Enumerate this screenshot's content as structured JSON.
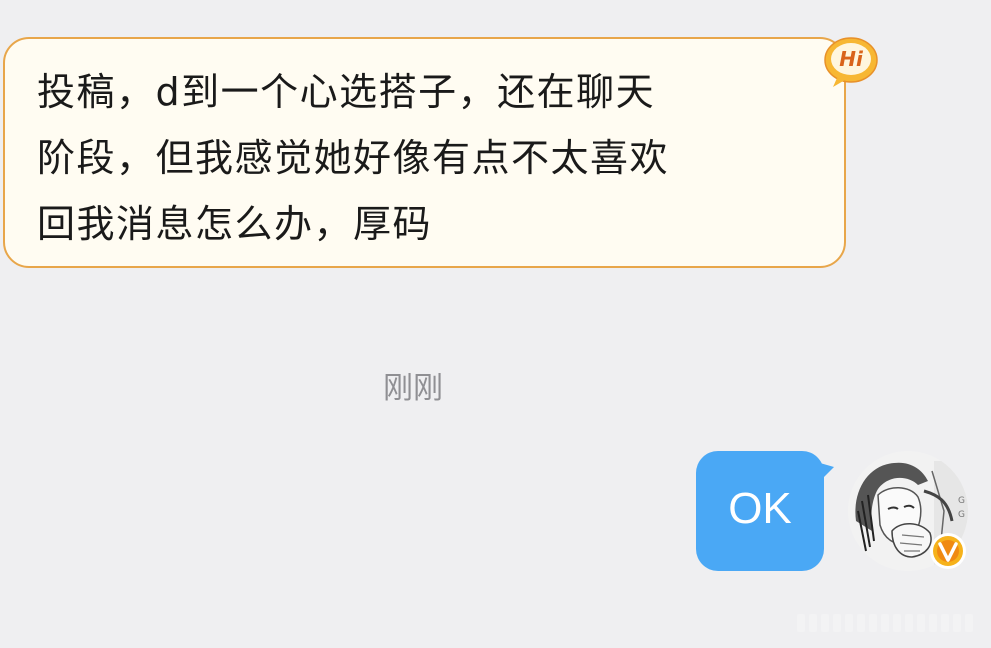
{
  "conversation": {
    "incoming_message": {
      "text": "投稿，d到一个心选搭子，还在聊天\n阶段，但我感觉她好像有点不太喜欢\n回我消息怎么办，厚码",
      "badge_text": "Hi",
      "badge_icon": "hi-speech-badge-icon"
    },
    "timestamp": "刚刚",
    "outgoing_message": {
      "text": "OK"
    },
    "avatar": {
      "icon": "user-avatar-sketch-icon",
      "verified_badge": "verified-v-badge-icon"
    }
  },
  "colors": {
    "background": "#efeff1",
    "incoming_bubble_fill": "#fffcf2",
    "incoming_bubble_border": "#e8a64a",
    "outgoing_bubble_fill": "#4aa8f5",
    "timestamp_text": "#8f8f93",
    "badge_orange": "#f0a020"
  }
}
